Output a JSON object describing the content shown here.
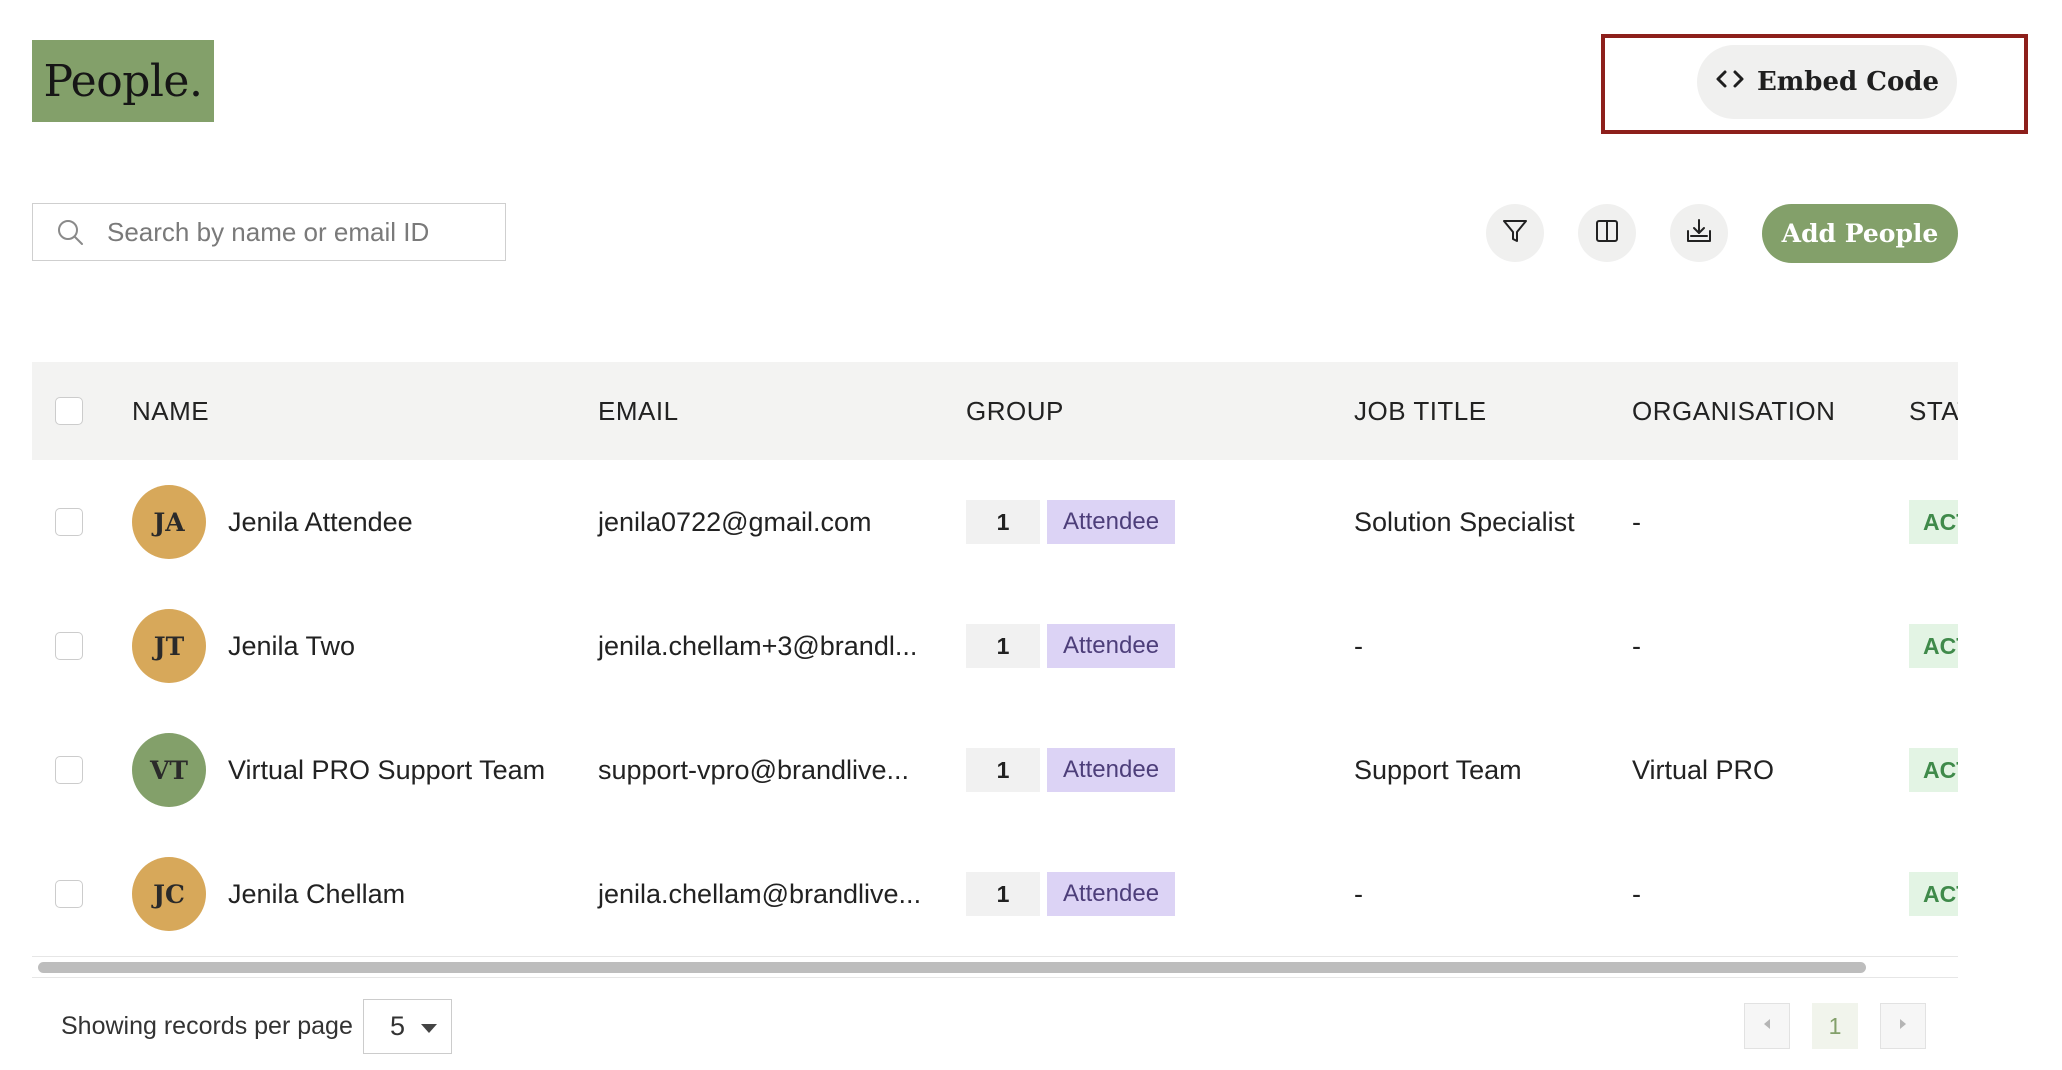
{
  "header": {
    "title": "People.",
    "embed_label": "Embed Code"
  },
  "toolbar": {
    "search_placeholder": "Search by name or email ID",
    "add_label": "Add People"
  },
  "table": {
    "columns": [
      "NAME",
      "EMAIL",
      "GROUP",
      "JOB TITLE",
      "ORGANISATION",
      "STATUS"
    ],
    "rows": [
      {
        "initials": "JA",
        "avatar_color": "#d7a85a",
        "name": "Jenila Attendee",
        "email": "jenila0722@gmail.com",
        "group_count": "1",
        "group": "Attendee",
        "job_title": "Solution Specialist",
        "organisation": "-",
        "status": "ACTIVE"
      },
      {
        "initials": "JT",
        "avatar_color": "#d7a85a",
        "name": "Jenila Two",
        "email": "jenila.chellam+3@brandl...",
        "group_count": "1",
        "group": "Attendee",
        "job_title": "-",
        "organisation": "-",
        "status": "ACTIVE"
      },
      {
        "initials": "VT",
        "avatar_color": "#83a06a",
        "name": "Virtual PRO Support Team",
        "email": "support-vpro@brandlive...",
        "group_count": "1",
        "group": "Attendee",
        "job_title": "Support Team",
        "organisation": "Virtual PRO",
        "status": "ACTIVE"
      },
      {
        "initials": "JC",
        "avatar_color": "#d7a85a",
        "name": "Jenila Chellam",
        "email": "jenila.chellam@brandlive...",
        "group_count": "1",
        "group": "Attendee",
        "job_title": "-",
        "organisation": "-",
        "status": "ACTIVE"
      }
    ]
  },
  "footer": {
    "per_page_label": "Showing records per page",
    "per_page_value": "5",
    "current_page": "1"
  },
  "colors": {
    "accent": "#83a06a",
    "highlight_border": "#8d1f1b",
    "group_tag_bg": "#dcd3f5",
    "status_bg": "#e3f4e4"
  }
}
